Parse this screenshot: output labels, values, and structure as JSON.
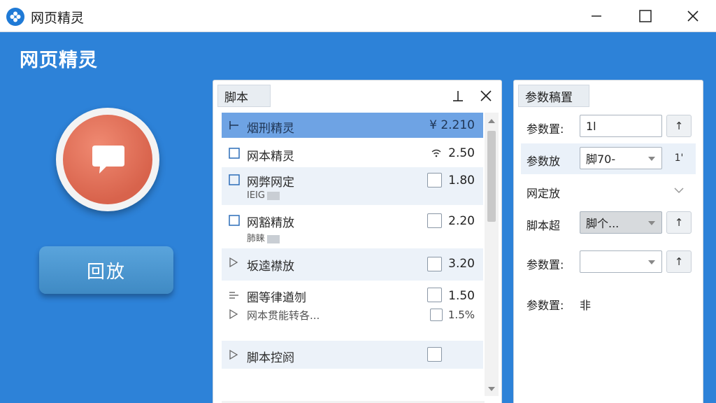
{
  "window": {
    "title": "网页精灵"
  },
  "main": {
    "heading": "网页精灵",
    "play_label": "回放"
  },
  "script_panel": {
    "tab_label": "脚本",
    "items": [
      {
        "name": "烟刑精灵",
        "sub": "",
        "value": "¥ 2.210"
      },
      {
        "name": "网本精灵",
        "sub": "",
        "value": "2.50"
      },
      {
        "name": "网弊网定",
        "sub": "IEIG",
        "value": "1.80"
      },
      {
        "name": "网豁精放",
        "sub": "肺睐",
        "value": "2.20"
      },
      {
        "name": "坂逵襟放",
        "sub": "",
        "value": "3.20"
      },
      {
        "name": "圈等律遒刎",
        "sub": "",
        "value": "1.50"
      },
      {
        "name": "网本贯能转各...",
        "sub": "",
        "value": "1.5%"
      },
      {
        "name": "脚本控阏",
        "sub": "",
        "value": ""
      }
    ]
  },
  "params_panel": {
    "tab_label": "参数稿置",
    "rows": [
      {
        "label": "参数置:",
        "value": "1l",
        "button": "↑"
      },
      {
        "label": "参数放",
        "value": "脚70-",
        "button": "1'"
      },
      {
        "label": "网定放",
        "value": "",
        "button": ""
      },
      {
        "label": "脚本超",
        "value": "脚个...",
        "button": "↑"
      },
      {
        "label": "参数置:",
        "value": "",
        "button": "↑"
      },
      {
        "label": "参数置:",
        "value": "非",
        "button": ""
      }
    ]
  },
  "colors": {
    "accent": "#2d82d8",
    "record": "#d8634c",
    "play": "#4a93cc",
    "selected_row": "#6ea3e4"
  }
}
